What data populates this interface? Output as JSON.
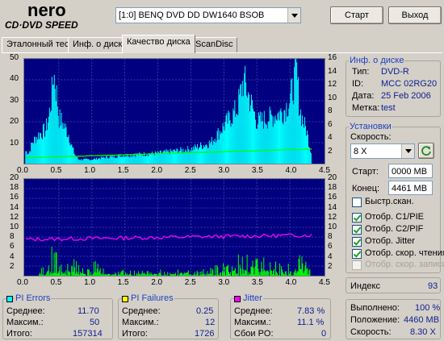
{
  "app": {
    "logo_line1": "nero",
    "logo_line2": "CD·DVD SPEED"
  },
  "drive": {
    "selected": "[1:0]  BENQ DVD DD DW1640 BSOB"
  },
  "buttons": {
    "start": "Старт",
    "exit": "Выход"
  },
  "tabs": [
    {
      "label": "Эталонный тест",
      "active": false
    },
    {
      "label": "Инф. о диске",
      "active": false
    },
    {
      "label": "Качество диска",
      "active": true
    },
    {
      "label": "ScanDisc",
      "active": false
    }
  ],
  "disc_info": {
    "title": "Инф. о диске",
    "type_label": "Тип:",
    "type_value": "DVD-R",
    "id_label": "ID:",
    "id_value": "MCC 02RG20",
    "date_label": "Дата:",
    "date_value": "25 Feb 2006",
    "mark_label": "Метка:",
    "mark_value": "test"
  },
  "settings": {
    "title": "Установки",
    "speed_label": "Скорость:",
    "speed_value": "8 X",
    "start_label": "Старт:",
    "start_value": "0000 MB",
    "end_label": "Конец:",
    "end_value": "4461 MB",
    "checks": [
      {
        "label": "Быстр.скан.",
        "checked": false,
        "enabled": true
      },
      {
        "label": "Отобр. C1/PIE",
        "checked": true,
        "enabled": true
      },
      {
        "label": "Отобр. C2/PIF",
        "checked": true,
        "enabled": true
      },
      {
        "label": "Отобр. Jitter",
        "checked": true,
        "enabled": true
      },
      {
        "label": "Отобр. скор. чтения",
        "checked": true,
        "enabled": true
      },
      {
        "label": "Отобр. скор. записи",
        "checked": false,
        "enabled": false
      }
    ]
  },
  "index": {
    "label": "Индекс",
    "value": "93"
  },
  "progress": {
    "done_label": "Выполнено:",
    "done_value": "100 %",
    "pos_label": "Положение:",
    "pos_value": "4460 MB",
    "speed_label": "Скорость:",
    "speed_value": "8.30 X"
  },
  "stats": {
    "pi_errors": {
      "title": "PI Errors",
      "color": "#00ffff",
      "avg_label": "Среднее:",
      "avg": "11.70",
      "max_label": "Максим.:",
      "max": "50",
      "total_label": "Итого:",
      "total": "157314"
    },
    "pi_failures": {
      "title": "PI Failures",
      "color": "#ffff00",
      "avg_label": "Среднее:",
      "avg": "0.25",
      "max_label": "Максим.:",
      "max": "12",
      "total_label": "Итого:",
      "total": "1726"
    },
    "jitter": {
      "title": "Jitter",
      "color": "#ff00ff",
      "avg_label": "Среднее:",
      "avg": "7.83 %",
      "max_label": "Максим.:",
      "max": "11.1 %",
      "po_label": "Сбои PO:",
      "po": "0"
    }
  },
  "chart_data": [
    {
      "type": "area",
      "x_ticks": [
        "0.0",
        "0.5",
        "1.0",
        "1.5",
        "2.0",
        "2.5",
        "3.0",
        "3.5",
        "4.0",
        "4.5"
      ],
      "y_left_ticks": [
        "10",
        "20",
        "30",
        "40",
        "50"
      ],
      "y_right_ticks": [
        "2",
        "4",
        "6",
        "8",
        "10",
        "12",
        "14",
        "16"
      ],
      "xlim": [
        0,
        4.5
      ],
      "ylim_left": [
        0,
        50
      ],
      "ylim_right": [
        0,
        16
      ],
      "series": [
        {
          "color": "#00ffff",
          "x": [
            0.0,
            0.05,
            0.1,
            0.2,
            0.3,
            0.35,
            0.4,
            0.42,
            0.45,
            0.48,
            0.5,
            0.55,
            0.6,
            0.65,
            0.7,
            0.75,
            0.8,
            0.9,
            1.0,
            1.2,
            1.5,
            2.0,
            2.5,
            2.8,
            3.0,
            3.2,
            3.3,
            3.5,
            3.7,
            3.9,
            4.0,
            4.1,
            4.15,
            4.2,
            4.25,
            4.3,
            4.33
          ],
          "values": [
            6,
            5,
            10,
            14,
            16,
            22,
            34,
            44,
            38,
            30,
            22,
            20,
            17,
            14,
            8,
            4,
            2,
            2,
            2,
            3,
            4,
            5,
            7,
            10,
            18,
            26,
            40,
            20,
            22,
            25,
            30,
            44,
            26,
            20,
            16,
            8,
            4
          ]
        },
        {
          "color": "#00ff00",
          "x": [
            0.0,
            4.33
          ],
          "values": [
            2.8,
            7.0
          ]
        }
      ]
    },
    {
      "type": "area",
      "x_ticks": [
        "0.0",
        "0.5",
        "1.0",
        "1.5",
        "2.0",
        "2.5",
        "3.0",
        "3.5",
        "4.0",
        "4.5"
      ],
      "y_left_ticks": [
        "2",
        "4",
        "6",
        "8",
        "10",
        "12",
        "14",
        "16",
        "18",
        "20"
      ],
      "y_right_ticks": [
        "2",
        "4",
        "6",
        "8",
        "10",
        "12",
        "14",
        "16",
        "18",
        "20"
      ],
      "xlim": [
        0,
        4.5
      ],
      "ylim_left": [
        0,
        20
      ],
      "ylim_right": [
        0,
        20
      ],
      "series": [
        {
          "color": "#00ff00",
          "x": [
            0.2,
            0.3,
            0.35,
            0.4,
            0.45,
            0.5,
            0.55,
            0.6,
            0.7,
            0.8,
            0.9,
            1.0,
            1.1,
            1.2,
            1.3,
            1.5,
            1.8,
            2.2,
            2.6,
            3.0,
            3.1,
            3.3,
            3.5,
            3.7,
            3.9,
            4.0,
            4.1,
            4.2,
            4.3,
            4.31
          ],
          "values": [
            1,
            2,
            3,
            5,
            4,
            4,
            3,
            2,
            3,
            2,
            1,
            3,
            2,
            1,
            1,
            1,
            1,
            1,
            1,
            2,
            3,
            4,
            4,
            3,
            2,
            2,
            3,
            4,
            6,
            12
          ]
        },
        {
          "color": "#ff00ff",
          "x": [
            0.0,
            4.33
          ],
          "values": [
            7.5,
            8.4
          ]
        }
      ]
    }
  ]
}
